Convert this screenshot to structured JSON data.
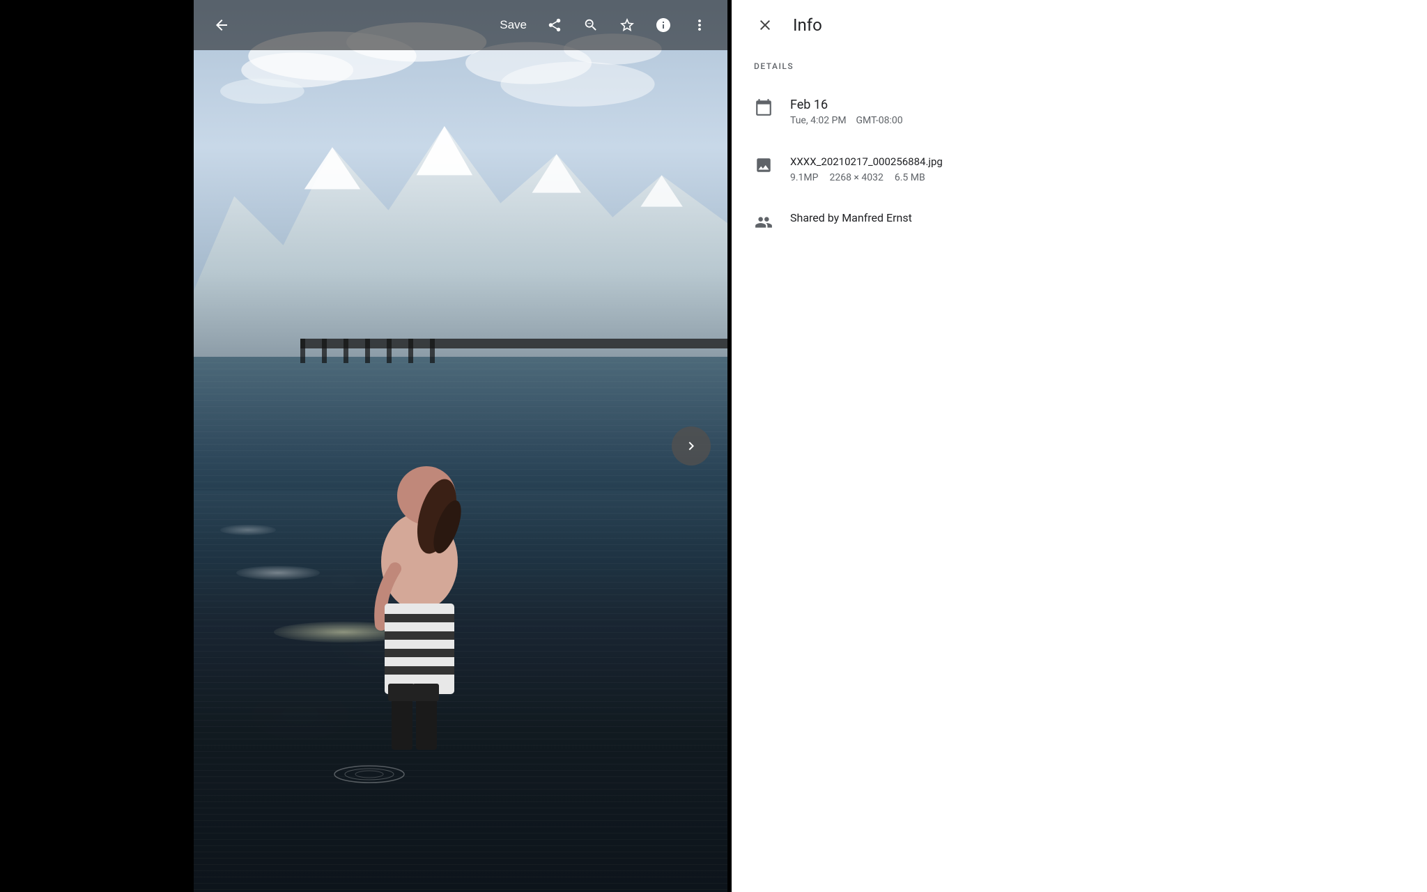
{
  "toolbar": {
    "save_label": "Save",
    "back_icon": "←",
    "share_icon": "share",
    "zoom_icon": "zoom",
    "star_icon": "star",
    "info_icon": "info",
    "more_icon": "more"
  },
  "photo": {
    "alt": "Girl standing in lake water with snowy mountains in background"
  },
  "next_button": {
    "icon": "›"
  },
  "info_panel": {
    "title": "Info",
    "close_label": "×",
    "details_section_label": "DETAILS",
    "date": {
      "day": "Feb 16",
      "time": "Tue, 4:02 PM",
      "timezone": "GMT-08:00"
    },
    "file": {
      "name": "XXXX_20210217_000256884.jpg",
      "megapixels": "9.1MP",
      "dimensions": "2268 × 4032",
      "size": "6.5 MB"
    },
    "shared": {
      "text": "Shared by Manfred Ernst"
    }
  }
}
